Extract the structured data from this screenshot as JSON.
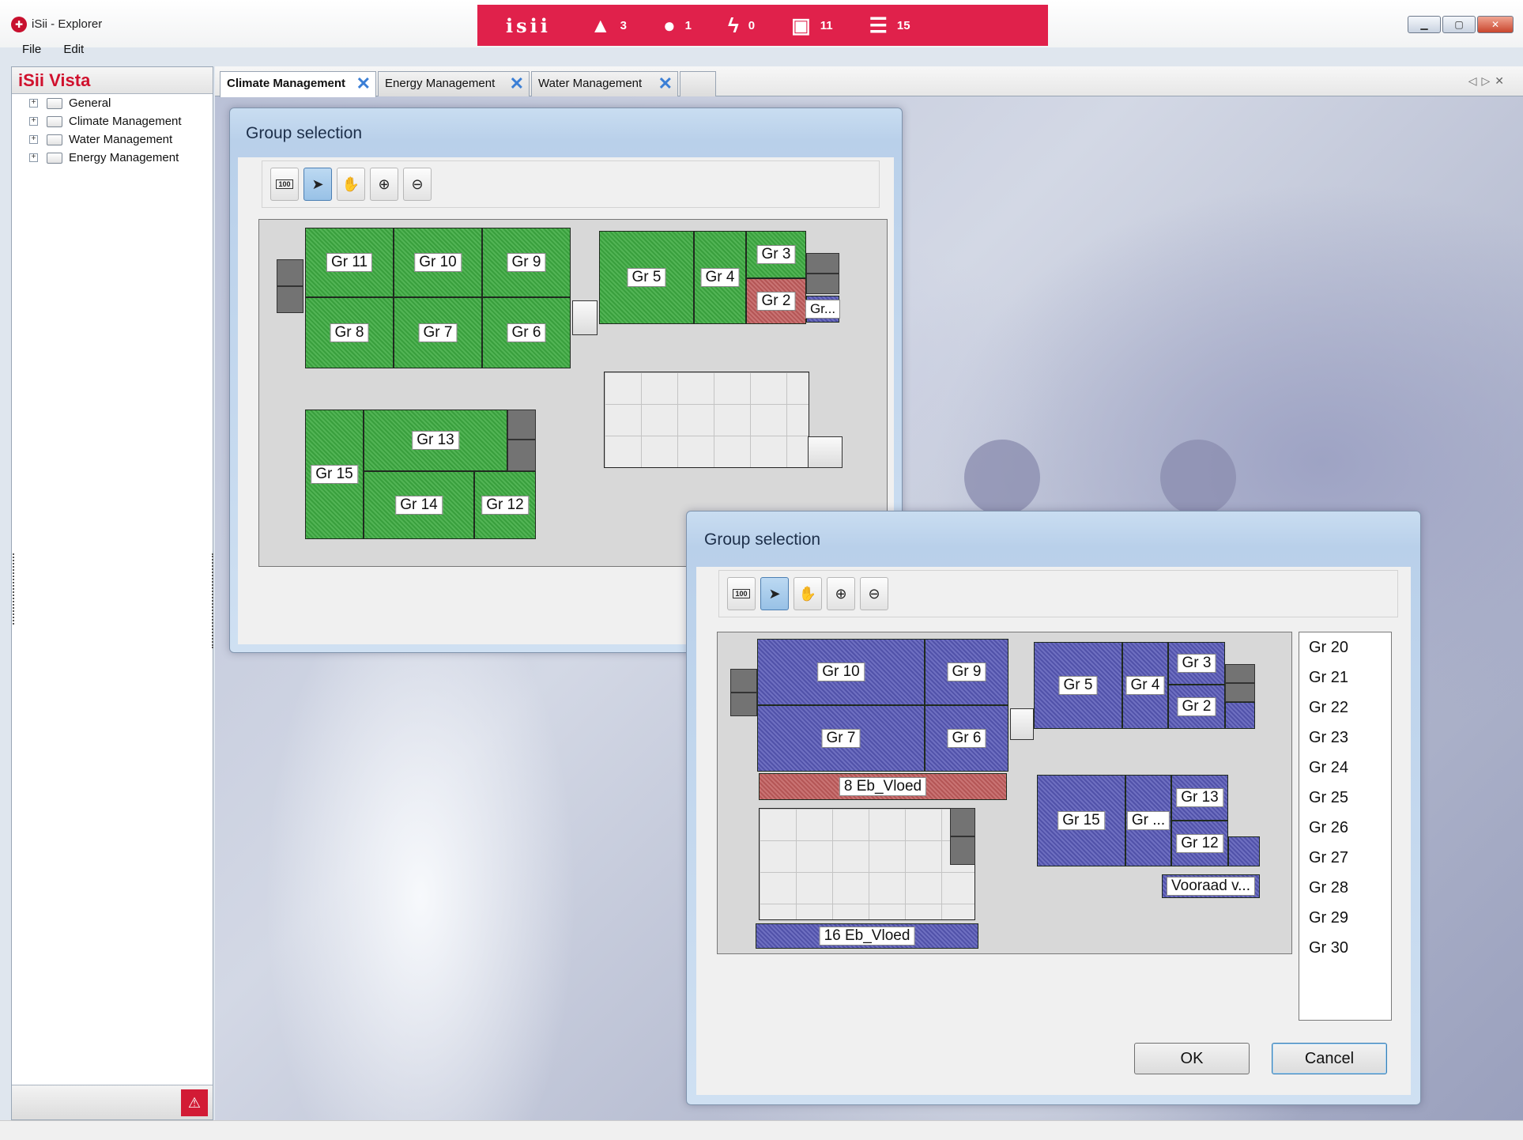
{
  "window": {
    "title": "iSii - Explorer",
    "menu": [
      "File",
      "Edit"
    ]
  },
  "statusbar": {
    "logo": "isii",
    "items": [
      {
        "icon": "flask-icon",
        "glyph": "▲",
        "count": "3"
      },
      {
        "icon": "drop-icon",
        "glyph": "●",
        "count": "1"
      },
      {
        "icon": "lightning-icon",
        "glyph": "ϟ",
        "count": "0"
      },
      {
        "icon": "group-icon",
        "glyph": "▣",
        "count": "11"
      },
      {
        "icon": "list-icon",
        "glyph": "☰",
        "count": "15"
      }
    ]
  },
  "sidebar": {
    "title": "iSii Vista",
    "items": [
      "General",
      "Climate Management",
      "Water Management",
      "Energy Management"
    ]
  },
  "tabs": [
    "Climate Management",
    "Energy Management",
    "Water Management"
  ],
  "dialog1": {
    "title": "Group selection",
    "groups": {
      "g11": "Gr 11",
      "g10": "Gr 10",
      "g9": "Gr 9",
      "g8": "Gr 8",
      "g7": "Gr 7",
      "g6": "Gr 6",
      "g5": "Gr 5",
      "g4": "Gr 4",
      "g3": "Gr 3",
      "g2": "Gr 2",
      "g1": "Gr...",
      "g13": "Gr 13",
      "g15": "Gr 15",
      "g14": "Gr 14",
      "g12": "Gr 12"
    }
  },
  "dialog2": {
    "title": "Group selection",
    "groups": {
      "g10": "Gr 10",
      "g9": "Gr 9",
      "g7": "Gr 7",
      "g6": "Gr 6",
      "ebvloed8": "8 Eb_Vloed",
      "g5": "Gr 5",
      "g4": "Gr 4",
      "g3": "Gr 3",
      "g2": "Gr 2",
      "g13": "Gr 13",
      "g15": "Gr 15",
      "gtrunc": "Gr ...",
      "g12": "Gr 12",
      "voorraad": "Vooraad v...",
      "ebvloed16": "16 Eb_Vloed"
    },
    "list": [
      "Gr 20",
      "Gr 21",
      "Gr 22",
      "Gr 23",
      "Gr 24",
      "Gr 25",
      "Gr 26",
      "Gr 27",
      "Gr 28",
      "Gr 29",
      "Gr 30"
    ],
    "ok_label": "OK",
    "cancel_label": "Cancel"
  },
  "colors": {
    "brand_red": "#e0214b",
    "green_group": "#3eac42",
    "blue_group": "#5a5bb8",
    "red_group": "#c26060"
  }
}
